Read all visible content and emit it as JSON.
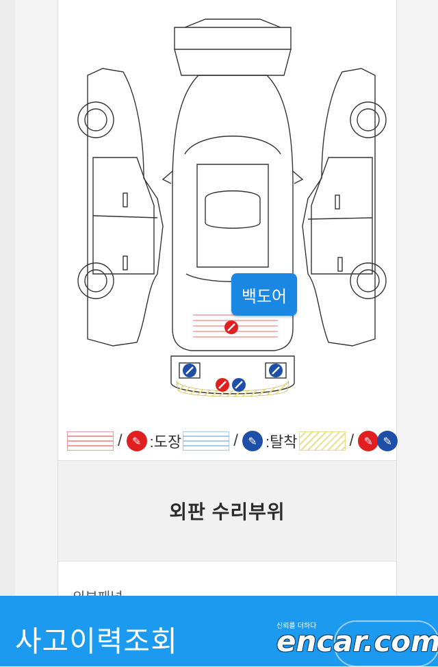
{
  "callout": {
    "label": "백도어"
  },
  "legend": {
    "paint_label": ":도장",
    "detach_label": ":탈착",
    "slash": "/",
    "paint_color": "#e02020",
    "detach_color": "#1d4fa8",
    "paint_hatch": "#f19a9a",
    "detach_hatch": "#a9c8ee",
    "both_hatch": "#eadf8a"
  },
  "section": {
    "title": "외판 수리부위",
    "next_label": "외부패널"
  },
  "bottom_bar": {
    "title": "사고이력조회",
    "color": "#1b9af0"
  },
  "watermark": {
    "tagline": "신뢰를 더하다",
    "brand": "encar.com"
  },
  "icons": {
    "paint": "paint-brush-icon",
    "detach": "wrench-icon"
  }
}
